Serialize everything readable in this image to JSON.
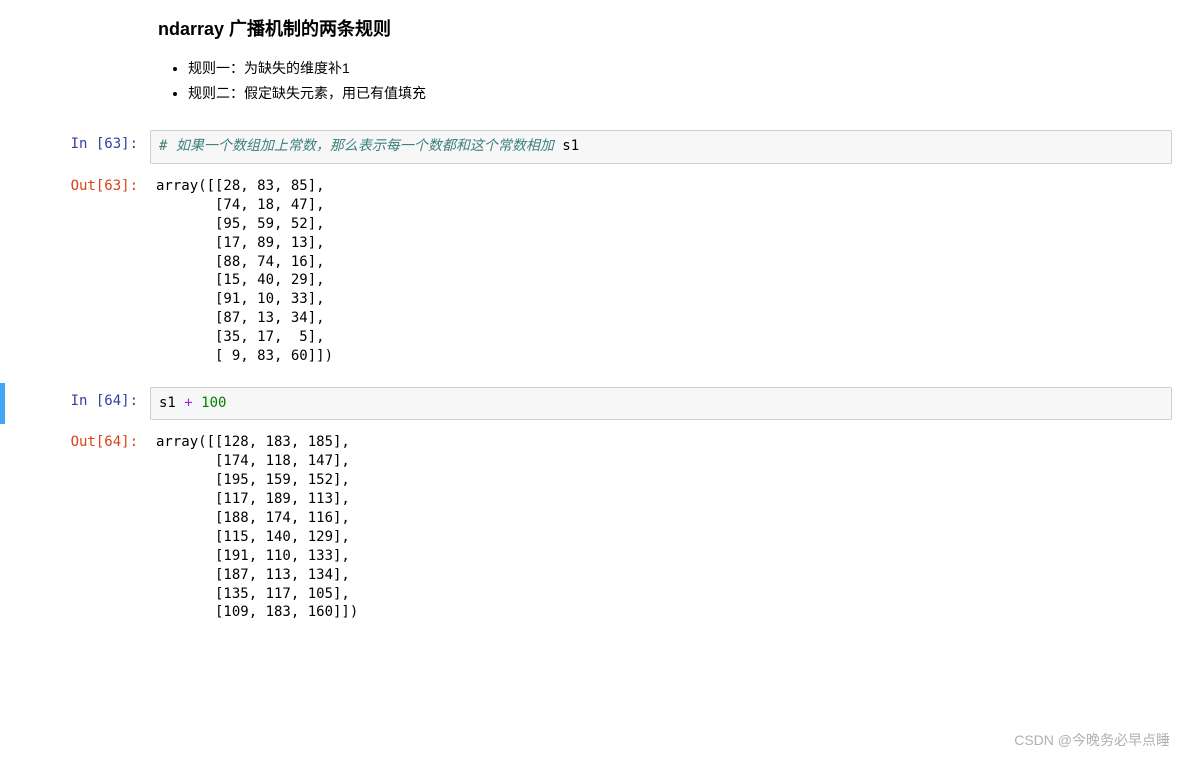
{
  "heading": "ndarray 广播机制的两条规则",
  "bullets": [
    "规则一：为缺失的维度补1",
    "规则二：假定缺失元素，用已有值填充"
  ],
  "cells": [
    {
      "in_prompt": "In  [63]: ",
      "code_comment": "# 如果一个数组加上常数，那么表示每一个数都和这个常数相加",
      "code_line2": "s1",
      "out_prompt": "Out[63]: ",
      "output": "array([[28, 83, 85],\n       [74, 18, 47],\n       [95, 59, 52],\n       [17, 89, 13],\n       [88, 74, 16],\n       [15, 40, 29],\n       [91, 10, 33],\n       [87, 13, 34],\n       [35, 17,  5],\n       [ 9, 83, 60]])"
    },
    {
      "in_prompt": "In  [64]: ",
      "code_var": "s1 ",
      "code_op": "+",
      "code_num": " 100",
      "out_prompt": "Out[64]: ",
      "output": "array([[128, 183, 185],\n       [174, 118, 147],\n       [195, 159, 152],\n       [117, 189, 113],\n       [188, 174, 116],\n       [115, 140, 129],\n       [191, 110, 133],\n       [187, 113, 134],\n       [135, 117, 105],\n       [109, 183, 160]])"
    }
  ],
  "watermark": "CSDN @今晚务必早点睡"
}
